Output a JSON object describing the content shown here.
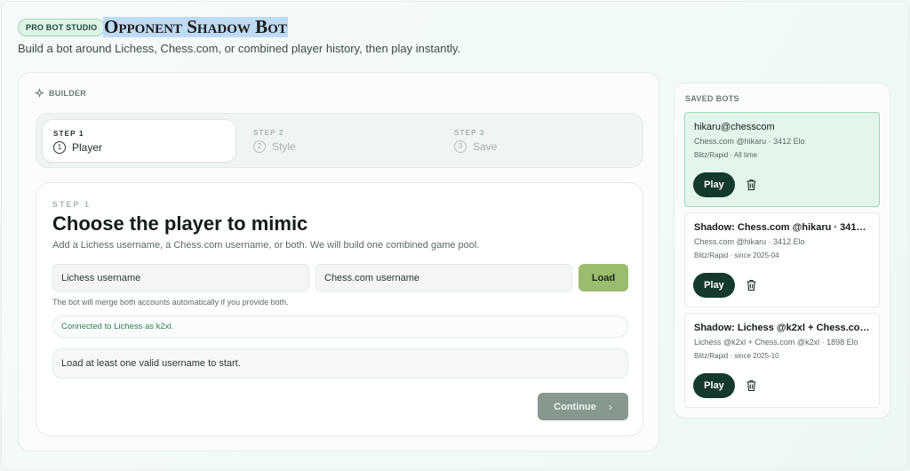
{
  "header": {
    "badge": "PRO BOT STUDIO",
    "title": "Opponent Shadow Bot",
    "subtitle": "Build a bot around Lichess, Chess.com, or combined player history, then play instantly."
  },
  "builder": {
    "label": "BUILDER",
    "steps": [
      {
        "num": "STEP 1",
        "index": "1",
        "name": "Player",
        "active": true
      },
      {
        "num": "STEP 2",
        "index": "2",
        "name": "Style",
        "active": false
      },
      {
        "num": "STEP 3",
        "index": "3",
        "name": "Save",
        "active": false
      }
    ],
    "card": {
      "eyebrow": "STEP 1",
      "heading": "Choose the player to mimic",
      "description": "Add a Lichess username, a Chess.com username, or both. We will build one combined game pool.",
      "lichess_placeholder": "Lichess username",
      "chesscom_placeholder": "Chess.com username",
      "load_label": "Load",
      "hint": "The bot will merge both accounts automatically if you provide both.",
      "connected": "Connected to Lichess as k2xl.",
      "notice": "Load at least one valid username to start.",
      "continue_label": "Continue",
      "continue_icon": "chevron-right-icon"
    }
  },
  "saved": {
    "label": "SAVED BOTS",
    "play_label": "Play",
    "bots": [
      {
        "title": "hikaru@chesscom",
        "meta": "Chess.com @hikaru · 3412 Elo",
        "sub": "Blitz/Rapid · All time",
        "selected": true
      },
      {
        "title": "Shadow: Chess.com @hikaru · 3412 ·…",
        "meta": "Chess.com @hikaru · 3412 Elo",
        "sub": "Blitz/Rapid · since 2025-04",
        "selected": false
      },
      {
        "title": "Shadow: Lichess @k2xl + Chess.co…",
        "meta": "Lichess @k2xl + Chess.com @k2xl · 1898 Elo",
        "sub": "Blitz/Rapid · since 2025-10",
        "selected": false
      }
    ]
  },
  "colors": {
    "accent_dark": "#133a2a",
    "load_green": "#9bbb6e",
    "selected_bg": "#e4f6ec"
  }
}
